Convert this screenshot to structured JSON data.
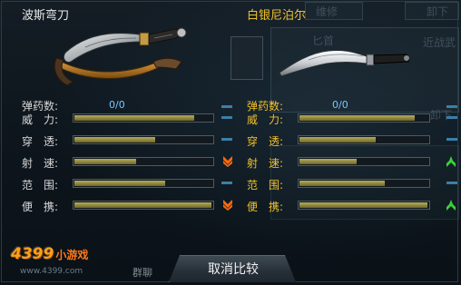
{
  "background": {
    "tab_repair": "维修",
    "tab_unequip_top": "卸下",
    "tab_dagger": "匕首",
    "tab_melee": "近战武",
    "tab_unequip_mid": "卸下",
    "chat": "群聊"
  },
  "left_weapon": {
    "name": "波斯弯刀",
    "ammo_label": "弹药数:",
    "ammo": "0/0",
    "stats": [
      {
        "label": "威　力:",
        "value": 0.86
      },
      {
        "label": "穿　透:",
        "value": 0.58
      },
      {
        "label": "射　速:",
        "value": 0.44
      },
      {
        "label": "范　围:",
        "value": 0.65
      },
      {
        "label": "便　携:",
        "value": 0.98
      }
    ]
  },
  "right_weapon": {
    "name": "白银尼泊尔",
    "ammo_label": "弹药数:",
    "ammo": "0/0",
    "stats": [
      {
        "label": "威　力:",
        "value": 0.88
      },
      {
        "label": "穿　透:",
        "value": 0.58
      },
      {
        "label": "射　速:",
        "value": 0.44
      },
      {
        "label": "范　围:",
        "value": 0.65
      },
      {
        "label": "便　携:",
        "value": 0.98
      }
    ]
  },
  "comparison": [
    "equal",
    "equal",
    "worse",
    "equal",
    "worse"
  ],
  "right_indicators": [
    "equal",
    "equal",
    "better",
    "equal",
    "better"
  ],
  "colors": {
    "bar_fill": "#a89f4e",
    "indicator": "#3b7fa8",
    "down_arrow": "#ff6a10",
    "up_arrow": "#3ad23a"
  },
  "cancel_button": "取消比较",
  "logo": {
    "main": "4399",
    "sub": "小游戏",
    "url": "www.4399.com"
  }
}
